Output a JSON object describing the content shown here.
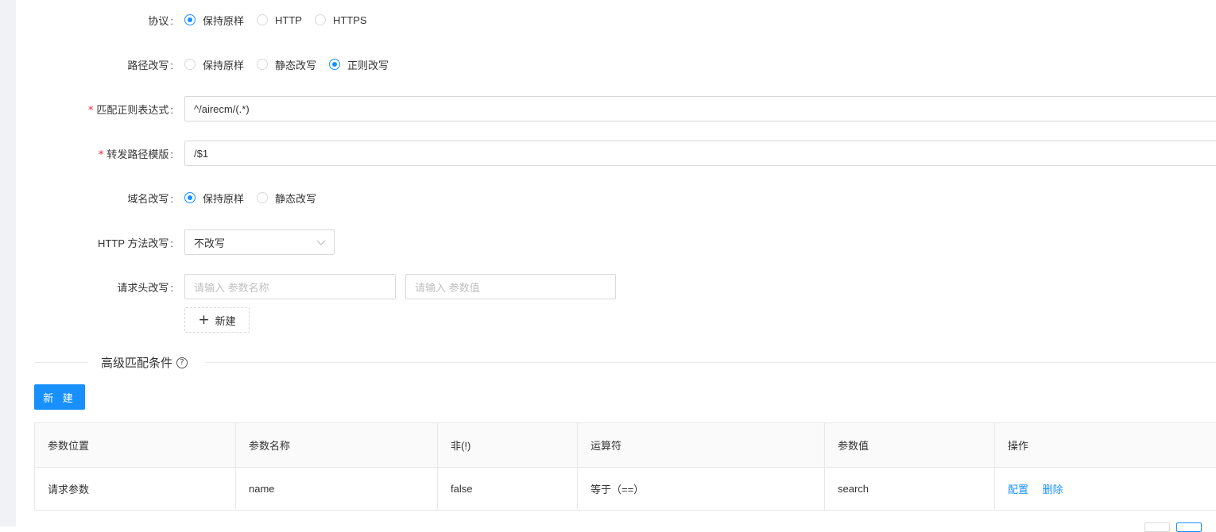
{
  "form": {
    "protocol": {
      "label": "协议",
      "options": [
        "保持原样",
        "HTTP",
        "HTTPS"
      ],
      "selected": 0
    },
    "path_rewrite": {
      "label": "路径改写",
      "options": [
        "保持原样",
        "静态改写",
        "正则改写"
      ],
      "selected": 2
    },
    "match_regex": {
      "label": "匹配正则表达式",
      "required": true,
      "value": "^/airecm/(.*)"
    },
    "forward_template": {
      "label": "转发路径模版",
      "required": true,
      "value": "/$1"
    },
    "host_rewrite": {
      "label": "域名改写",
      "options": [
        "保持原样",
        "静态改写"
      ],
      "selected": 0
    },
    "http_method": {
      "label": "HTTP 方法改写",
      "value": "不改写"
    },
    "header_rewrite": {
      "label": "请求头改写",
      "name_placeholder": "请输入 参数名称",
      "value_placeholder": "请输入 参数值",
      "add_label": "新建"
    }
  },
  "advanced": {
    "title": "高级匹配条件",
    "help_icon": "question-circle-icon",
    "new_button": "新 建",
    "table": {
      "columns": [
        "参数位置",
        "参数名称",
        "非(!)",
        "运算符",
        "参数值",
        "操作"
      ],
      "rows": [
        {
          "position": "请求参数",
          "name": "name",
          "negate": "false",
          "operator": "等于（==）",
          "value": "search",
          "actions": [
            "配置",
            "删除"
          ]
        }
      ]
    }
  },
  "colors": {
    "primary": "#1890ff",
    "required": "#f5222d",
    "border": "#d9d9d9"
  }
}
